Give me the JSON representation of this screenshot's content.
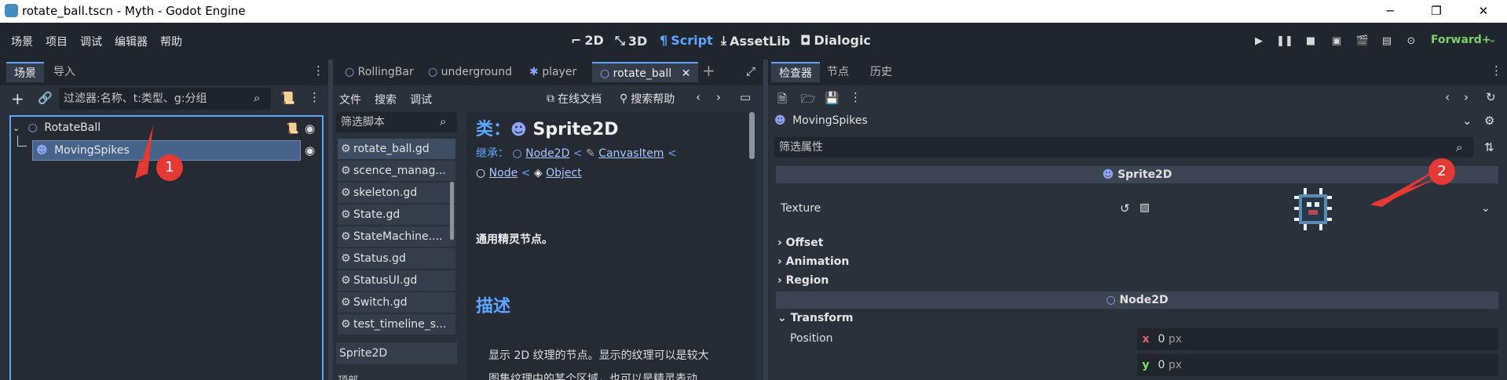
{
  "window": {
    "title": "rotate_ball.tscn - Myth - Godot Engine",
    "minimize": "─",
    "maximize": "❐",
    "close": "✕"
  },
  "menu": [
    "场景",
    "项目",
    "调试",
    "编辑器",
    "帮助"
  ],
  "workspaces": [
    {
      "icon": "⌐",
      "label": "2D"
    },
    {
      "icon": "⤡",
      "label": "3D"
    },
    {
      "icon": "¶",
      "label": "Script"
    },
    {
      "icon": "⤓",
      "label": "AssetLib"
    },
    {
      "icon": "◘",
      "label": "Dialogic"
    }
  ],
  "play_controls": [
    "▶",
    "❚❚",
    "■",
    "▣",
    "🎬",
    "▤",
    "⊙"
  ],
  "renderer": "Forward+",
  "scene_panel": {
    "tabs": [
      "场景",
      "导入"
    ],
    "filter_placeholder": "过滤器:名称、t:类型、g:分组",
    "root_node": "RotateBall",
    "child_node": "MovingSpikes"
  },
  "script_tabs": [
    "RollingBar",
    "underground",
    "player",
    "rotate_ball"
  ],
  "script_menu": [
    "文件",
    "搜索",
    "调试"
  ],
  "script_actions": {
    "online_docs": "在线文档",
    "search_help": "搜索帮助"
  },
  "script_filter": "筛选脚本",
  "scripts": [
    "rotate_ball.gd",
    "scence_manag...",
    "skeleton.gd",
    "State.gd",
    "StateMachine....",
    "Status.gd",
    "StatusUI.gd",
    "Switch.gd",
    "test_timeline_s..."
  ],
  "members_label": "Sprite2D",
  "members_sub": "顶部",
  "doc": {
    "class_prefix": "类：",
    "class_name": "Sprite2D",
    "inherits_label": "继承：",
    "chain1": "Node2D",
    "chain2": "CanvasItem",
    "chain3": "Node",
    "chain4": "Object",
    "lt": "<",
    "brief": "通用精灵节点。",
    "desc_title": "描述",
    "desc_text1": "显示 2D 纹理的节点。显示的纹理可以是较大",
    "desc_text2": "图集纹理中的某个区域，也可以是精灵表动"
  },
  "inspector": {
    "tabs": [
      "检查器",
      "节点",
      "历史"
    ],
    "node_name": "MovingSpikes",
    "filter_placeholder": "筛选属性",
    "section1": "Sprite2D",
    "texture_label": "Texture",
    "groups": [
      "Offset",
      "Animation",
      "Region"
    ],
    "section2": "Node2D",
    "transform": "Transform",
    "position_label": "Position",
    "pos_x": "0",
    "pos_y": "0",
    "unit": "px"
  },
  "annotations": [
    "1",
    "2"
  ],
  "colors": {
    "accent": "#5da6ff",
    "node_icon": "#8da5f3",
    "callout": "#e53935",
    "x_axis": "#e5645e",
    "y_axis": "#7be36a"
  }
}
